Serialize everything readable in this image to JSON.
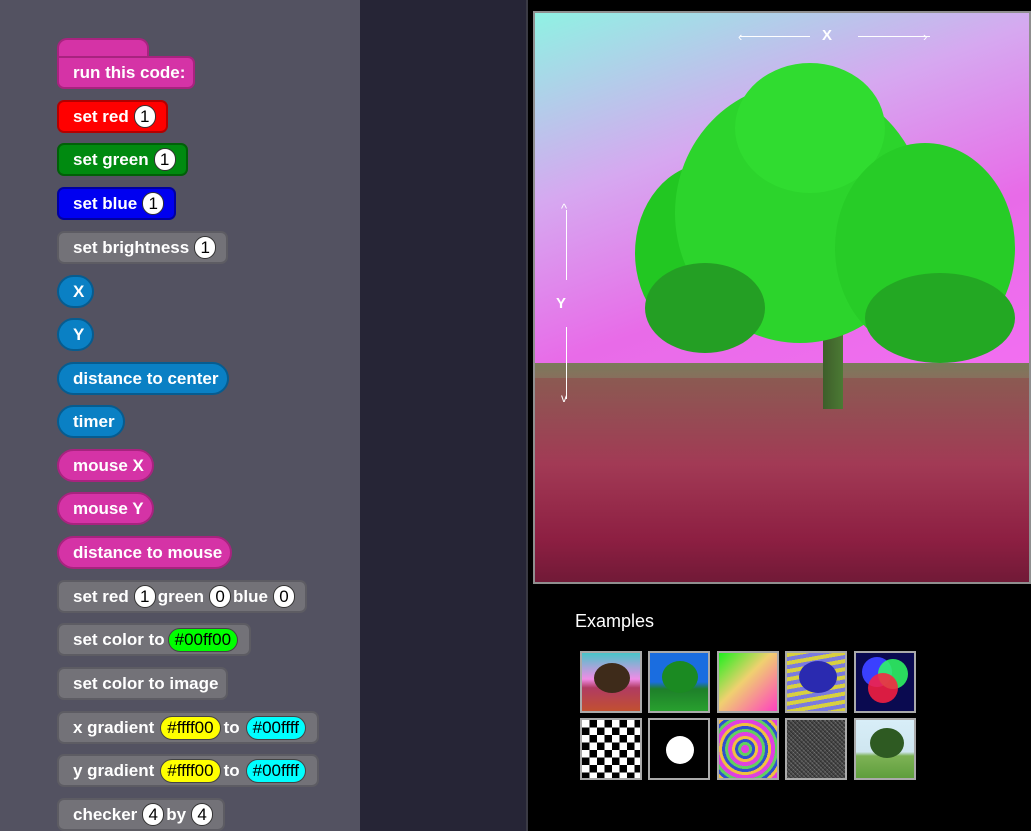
{
  "blocks": {
    "run": "run this code:",
    "set_red": {
      "label": "set red",
      "value": "1"
    },
    "set_green": {
      "label": "set green",
      "value": "1"
    },
    "set_blue": {
      "label": "set blue",
      "value": "1"
    },
    "set_brightness": {
      "label": "set brightness",
      "value": "1"
    },
    "x": "X",
    "y": "Y",
    "distance_center": "distance to center",
    "timer": "timer",
    "mouse_x": "mouse X",
    "mouse_y": "mouse Y",
    "distance_mouse": "distance to mouse",
    "set_rgb": {
      "l1": "set red",
      "v1": "1",
      "l2": "green",
      "v2": "0",
      "l3": "blue",
      "v3": "0"
    },
    "set_color": {
      "label": "set color to",
      "value": "#00ff00"
    },
    "set_color_image": "set color to image",
    "x_gradient": {
      "label": "x gradient",
      "from": "#ffff00",
      "to_label": "to",
      "to": "#00ffff"
    },
    "y_gradient": {
      "label": "y gradient",
      "from": "#ffff00",
      "to_label": "to",
      "to": "#00ffff"
    },
    "checker": {
      "label": "checker",
      "v1": "4",
      "by": "by",
      "v2": "4"
    }
  },
  "canvas": {
    "x_label": "X",
    "y_label": "Y"
  },
  "examples": {
    "title": "Examples",
    "items": [
      {
        "icon": "tree-rainbow"
      },
      {
        "icon": "tree-blue-green"
      },
      {
        "icon": "color-gradient"
      },
      {
        "icon": "tree-striped"
      },
      {
        "icon": "rgb-circles"
      },
      {
        "icon": "checkerboard"
      },
      {
        "icon": "white-dot"
      },
      {
        "icon": "psychedelic-waves"
      },
      {
        "icon": "noise"
      },
      {
        "icon": "tree-original"
      }
    ]
  },
  "colors": {
    "pink": "#d533a6",
    "red": "#ff0000",
    "green": "#008a10",
    "blue": "#0000f0",
    "gray": "#737278",
    "teal": "#0a80c4",
    "yellow_pill": "#ffff00",
    "cyan_pill": "#00ffff",
    "green_pill": "#00ff00"
  }
}
